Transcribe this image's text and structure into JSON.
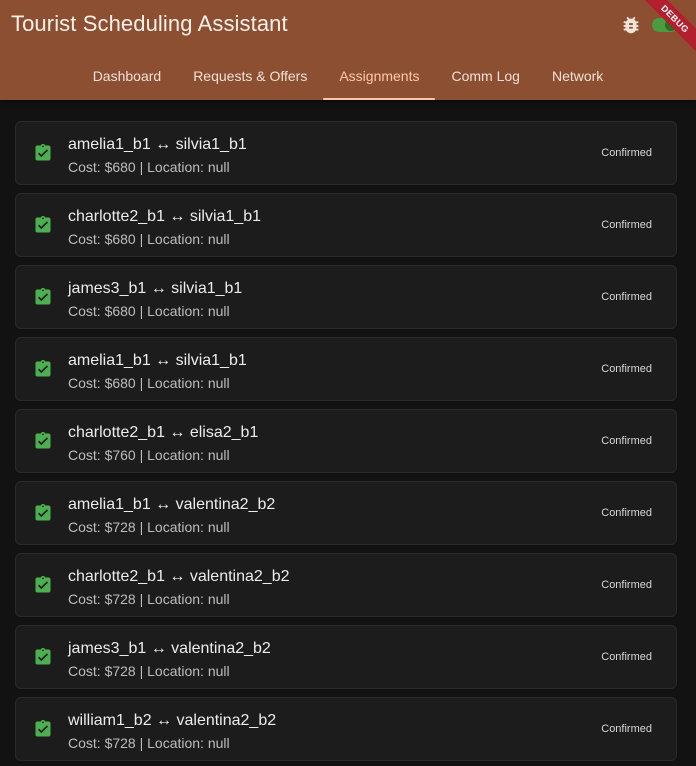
{
  "app": {
    "title": "Tourist Scheduling Assistant",
    "debug_banner": "DEBUG",
    "colors": {
      "appbar": "#8c4f32",
      "accent": "#ffc9a8",
      "success": "#4caf50"
    }
  },
  "tabs": [
    {
      "label": "Dashboard",
      "active": false
    },
    {
      "label": "Requests & Offers",
      "active": false
    },
    {
      "label": "Assignments",
      "active": true
    },
    {
      "label": "Comm Log",
      "active": false
    },
    {
      "label": "Network",
      "active": false
    }
  ],
  "assignments": [
    {
      "title": "amelia1_b1 ↔ silvia1_b1",
      "subtitle": "Cost: $680 | Location: null",
      "status": "Confirmed",
      "icon": "assignment-turned-in-icon"
    },
    {
      "title": "charlotte2_b1 ↔ silvia1_b1",
      "subtitle": "Cost: $680 | Location: null",
      "status": "Confirmed",
      "icon": "assignment-turned-in-icon"
    },
    {
      "title": "james3_b1 ↔ silvia1_b1",
      "subtitle": "Cost: $680 | Location: null",
      "status": "Confirmed",
      "icon": "assignment-turned-in-icon"
    },
    {
      "title": "amelia1_b1 ↔ silvia1_b1",
      "subtitle": "Cost: $680 | Location: null",
      "status": "Confirmed",
      "icon": "assignment-turned-in-icon"
    },
    {
      "title": "charlotte2_b1 ↔ elisa2_b1",
      "subtitle": "Cost: $760 | Location: null",
      "status": "Confirmed",
      "icon": "assignment-turned-in-icon"
    },
    {
      "title": "amelia1_b1 ↔ valentina2_b2",
      "subtitle": "Cost: $728 | Location: null",
      "status": "Confirmed",
      "icon": "assignment-turned-in-icon"
    },
    {
      "title": "charlotte2_b1 ↔ valentina2_b2",
      "subtitle": "Cost: $728 | Location: null",
      "status": "Confirmed",
      "icon": "assignment-turned-in-icon"
    },
    {
      "title": "james3_b1 ↔ valentina2_b2",
      "subtitle": "Cost: $728 | Location: null",
      "status": "Confirmed",
      "icon": "assignment-turned-in-icon"
    },
    {
      "title": "william1_b2 ↔ valentina2_b2",
      "subtitle": "Cost: $728 | Location: null",
      "status": "Confirmed",
      "icon": "assignment-turned-in-icon"
    }
  ]
}
